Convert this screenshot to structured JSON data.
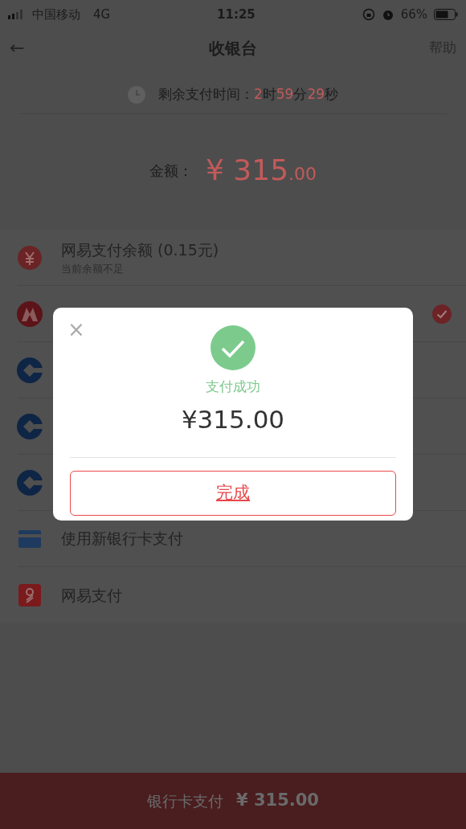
{
  "status_bar": {
    "carrier": "中国移动",
    "network": "4G",
    "time": "11:25",
    "battery": "66%"
  },
  "nav": {
    "back": "←",
    "title": "收银台",
    "help": "帮助"
  },
  "countdown": {
    "label": "剩余支付时间：",
    "parts": [
      {
        "value": "2",
        "unit": "时"
      },
      {
        "value": "59",
        "unit": "分"
      },
      {
        "value": "29",
        "unit": "秒"
      }
    ]
  },
  "amount": {
    "label": "金额：",
    "currency": "¥",
    "integer": "315",
    "decimal": ".00"
  },
  "methods": [
    {
      "kind": "balance",
      "name": "网易支付余额 (0.15元)",
      "note": "当前余额不足",
      "selected": false
    },
    {
      "kind": "cmb",
      "selected": true
    },
    {
      "kind": "ccb",
      "selected": false
    },
    {
      "kind": "ccb",
      "selected": false
    },
    {
      "kind": "ccb",
      "selected": false
    },
    {
      "kind": "card",
      "name": "使用新银行卡支付",
      "selected": false
    },
    {
      "kind": "epay",
      "name": "网易支付",
      "selected": false
    }
  ],
  "pay_button": {
    "label": "银行卡支付",
    "amount": "¥ 315.00"
  },
  "dialog": {
    "close": "×",
    "status": "支付成功",
    "amount": "¥315.00",
    "button": "完成"
  }
}
